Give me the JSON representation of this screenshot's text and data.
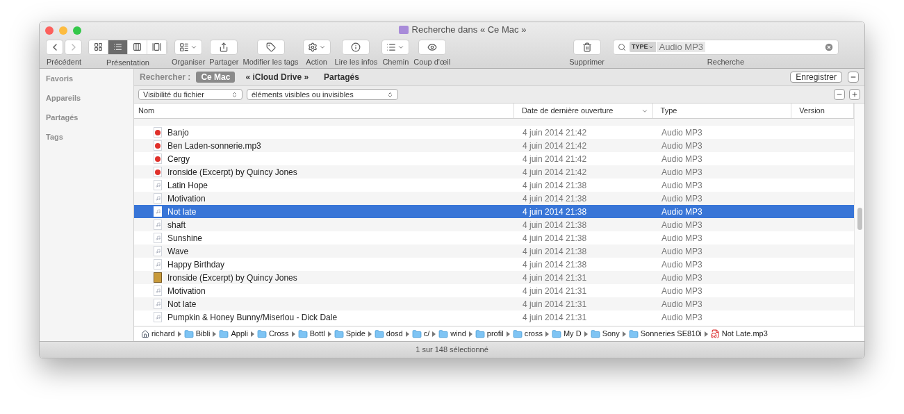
{
  "window": {
    "title": "Recherche dans « Ce Mac »"
  },
  "toolbar": {
    "navigation": {
      "label": "Précédent"
    },
    "views": {
      "label": "Présentation",
      "items": [
        {
          "kind": "icons",
          "selected": false
        },
        {
          "kind": "list",
          "selected": true
        },
        {
          "kind": "columns",
          "selected": false
        },
        {
          "kind": "coverflow",
          "selected": false
        }
      ]
    },
    "buttons": [
      {
        "kind": "organize",
        "label": "Organiser"
      },
      {
        "kind": "share",
        "label": "Partager"
      },
      {
        "kind": "tags",
        "label": "Modifier les tags"
      },
      {
        "kind": "action",
        "label": "Action"
      },
      {
        "kind": "info",
        "label": "Lire les infos"
      },
      {
        "kind": "path",
        "label": "Chemin"
      },
      {
        "kind": "quicklook",
        "label": "Coup d'œil"
      }
    ],
    "delete": {
      "label": "Supprimer"
    },
    "search": {
      "label": "Recherche",
      "token_type": "TYPE",
      "token_value": "Audio MP3"
    }
  },
  "sidebar": {
    "items": [
      "Favoris",
      "Appareils",
      "Partagés",
      "Tags"
    ]
  },
  "scope_bar": {
    "label": "Rechercher :",
    "scopes": [
      {
        "label": "Ce Mac",
        "selected": true
      },
      {
        "label": "« iCloud Drive »",
        "selected": false
      },
      {
        "label": "Partagés",
        "selected": false
      }
    ],
    "save_button": "Enregistrer"
  },
  "criteria": {
    "attribute": "Visibilité du fichier",
    "value": "éléments visibles ou invisibles"
  },
  "table": {
    "columns": [
      {
        "label": "Nom",
        "sorted": false
      },
      {
        "label": "Date de dernière ouverture",
        "sorted": true
      },
      {
        "label": "Type",
        "sorted": false
      },
      {
        "label": "Version",
        "sorted": false
      }
    ],
    "rows": [
      {
        "kind": "mp3",
        "name": "Banjo",
        "date": "4 juin 2014 21:42",
        "type": "Audio MP3",
        "selected": false
      },
      {
        "kind": "mp3",
        "name": "Ben Laden-sonnerie.mp3",
        "date": "4 juin 2014 21:42",
        "type": "Audio MP3",
        "selected": false
      },
      {
        "kind": "mp3",
        "name": "Cergy",
        "date": "4 juin 2014 21:42",
        "type": "Audio MP3",
        "selected": false
      },
      {
        "kind": "mp3",
        "name": "Ironside (Excerpt) by Quincy Jones",
        "date": "4 juin 2014 21:42",
        "type": "Audio MP3",
        "selected": false
      },
      {
        "kind": "generic",
        "name": "Latin Hope",
        "date": "4 juin 2014 21:38",
        "type": "Audio MP3",
        "selected": false
      },
      {
        "kind": "generic",
        "name": "Motivation",
        "date": "4 juin 2014 21:38",
        "type": "Audio MP3",
        "selected": false
      },
      {
        "kind": "generic",
        "name": "Not late",
        "date": "4 juin 2014 21:38",
        "type": "Audio MP3",
        "selected": true
      },
      {
        "kind": "generic",
        "name": "shaft",
        "date": "4 juin 2014 21:38",
        "type": "Audio MP3",
        "selected": false
      },
      {
        "kind": "generic",
        "name": "Sunshine",
        "date": "4 juin 2014 21:38",
        "type": "Audio MP3",
        "selected": false
      },
      {
        "kind": "generic",
        "name": "Wave",
        "date": "4 juin 2014 21:38",
        "type": "Audio MP3",
        "selected": false
      },
      {
        "kind": "generic",
        "name": "Happy Birthday",
        "date": "4 juin 2014 21:38",
        "type": "Audio MP3",
        "selected": false
      },
      {
        "kind": "artwork",
        "name": "Ironside (Excerpt) by Quincy Jones",
        "date": "4 juin 2014 21:31",
        "type": "Audio MP3",
        "selected": false
      },
      {
        "kind": "generic",
        "name": "Motivation",
        "date": "4 juin 2014 21:31",
        "type": "Audio MP3",
        "selected": false
      },
      {
        "kind": "generic",
        "name": "Not late",
        "date": "4 juin 2014 21:31",
        "type": "Audio MP3",
        "selected": false
      },
      {
        "kind": "generic",
        "name": "Pumpkin & Honey Bunny/Miserlou - Dick Dale",
        "date": "4 juin 2014 21:31",
        "type": "Audio MP3",
        "selected": false
      }
    ]
  },
  "path_bar": [
    {
      "kind": "home",
      "label": "richard"
    },
    {
      "kind": "folder",
      "label": "Bibli"
    },
    {
      "kind": "folder",
      "label": "Appli"
    },
    {
      "kind": "folder",
      "label": "Cross"
    },
    {
      "kind": "folder",
      "label": "Bottl"
    },
    {
      "kind": "folder",
      "label": "Spide"
    },
    {
      "kind": "folder",
      "label": "dosd"
    },
    {
      "kind": "folder",
      "label": "c/"
    },
    {
      "kind": "folder",
      "label": "wind"
    },
    {
      "kind": "folder",
      "label": "profil"
    },
    {
      "kind": "folder",
      "label": "cross"
    },
    {
      "kind": "folder",
      "label": "My D"
    },
    {
      "kind": "folder",
      "label": "Sony"
    },
    {
      "kind": "folder",
      "label": "Sonneries SE810i"
    },
    {
      "kind": "mp3",
      "label": "Not Late.mp3"
    }
  ],
  "status_bar": "1 sur 148 sélectionné"
}
